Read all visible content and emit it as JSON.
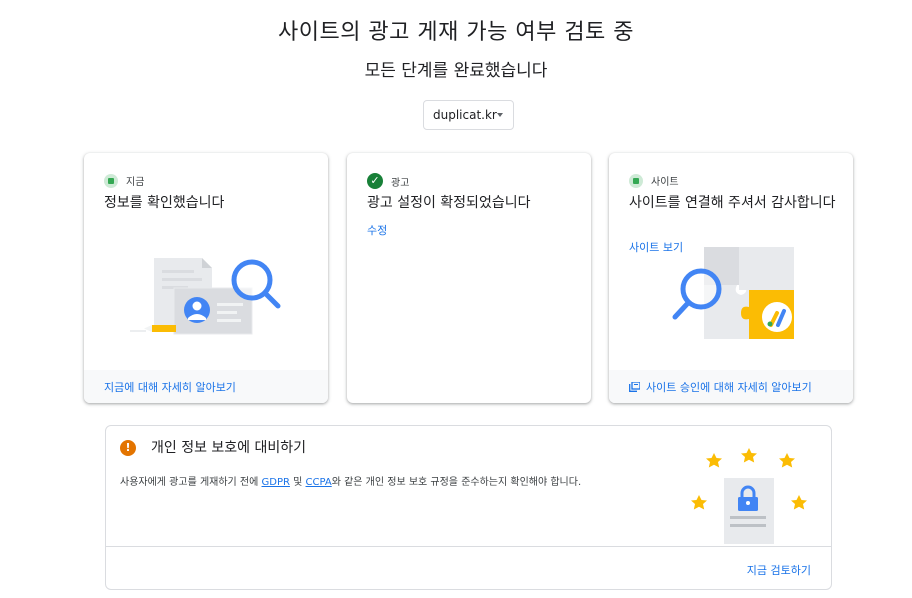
{
  "header": {
    "title": "사이트의 광고 게재 가능 여부 검토 중",
    "subtitle": "모든 단계를 완료했습니다"
  },
  "site_select": {
    "value": "duplicat.kr"
  },
  "cards": [
    {
      "status_label": "지금",
      "title": "정보를 확인했습니다",
      "footer_link": "지금에 대해 자세히 알아보기"
    },
    {
      "status_label": "광고",
      "title": "광고 설정이 확정되었습니다",
      "link": "수정"
    },
    {
      "status_label": "사이트",
      "title": "사이트를 연결해 주셔서 감사합니다",
      "link": "사이트 보기",
      "footer_link": "사이트 승인에 대해 자세히 알아보기"
    }
  ],
  "privacy": {
    "title": "개인 정보 보호에 대비하기",
    "body_prefix": "사용자에게 광고를 게재하기 전에 ",
    "gdpr": "GDPR",
    "and": " 및 ",
    "ccpa": "CCPA",
    "body_suffix": "와 같은 개인 정보 보호 규정을 준수하는지 확인해야 합니다.",
    "review_link": "지금 검토하기"
  },
  "colors": {
    "accent": "#1a73e8",
    "success": "#188038",
    "warning": "#e37400",
    "star": "#fbbc04"
  }
}
